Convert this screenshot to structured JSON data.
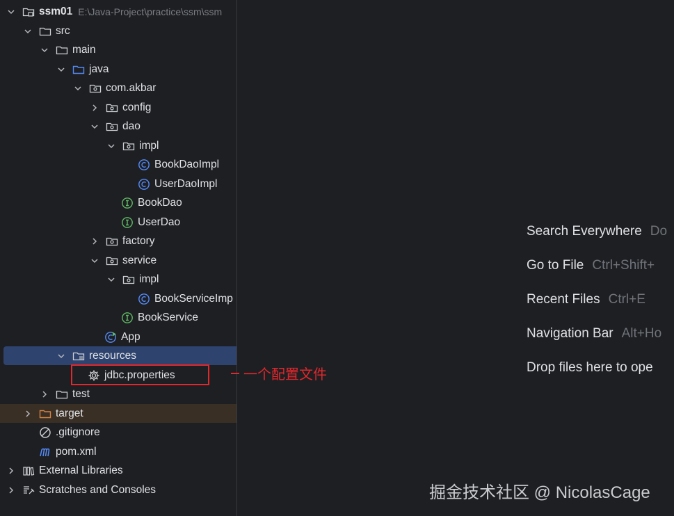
{
  "tree": {
    "project_name": "ssm01",
    "project_path": "E:\\Java-Project\\practice\\ssm\\ssm",
    "nodes": {
      "src": "src",
      "main": "main",
      "java": "java",
      "com_akbar": "com.akbar",
      "config": "config",
      "dao": "dao",
      "dao_impl": "impl",
      "BookDaoImpl": "BookDaoImpl",
      "UserDaoImpl": "UserDaoImpl",
      "BookDao": "BookDao",
      "UserDao": "UserDao",
      "factory": "factory",
      "service": "service",
      "service_impl": "impl",
      "BookServiceImp": "BookServiceImp",
      "BookService": "BookService",
      "App": "App",
      "resources": "resources",
      "jdbc_properties": "jdbc.properties",
      "test": "test",
      "target": "target",
      "gitignore": ".gitignore",
      "pom_xml": "pom.xml",
      "external_libraries": "External Libraries",
      "scratches": "Scratches and Consoles"
    }
  },
  "welcome": {
    "search_everywhere": "Search Everywhere",
    "search_everywhere_key": "Do",
    "go_to_file": "Go to File",
    "go_to_file_key": "Ctrl+Shift+",
    "recent_files": "Recent Files",
    "recent_files_key": "Ctrl+E",
    "navigation_bar": "Navigation Bar",
    "navigation_bar_key": "Alt+Ho",
    "drop_files": "Drop files here to ope"
  },
  "annotation": {
    "text": "一个配置文件"
  },
  "watermark": {
    "text": "掘金技术社区 @ NicolasCage"
  },
  "colors": {
    "background": "#1e1f22",
    "selection": "#2e436e",
    "excluded_row": "#3a2f25",
    "class_icon": "#548af7",
    "interface_icon": "#5fb865",
    "folder_blue": "#548af7",
    "folder_orange": "#d28445",
    "annotation_red": "#e0282d"
  }
}
